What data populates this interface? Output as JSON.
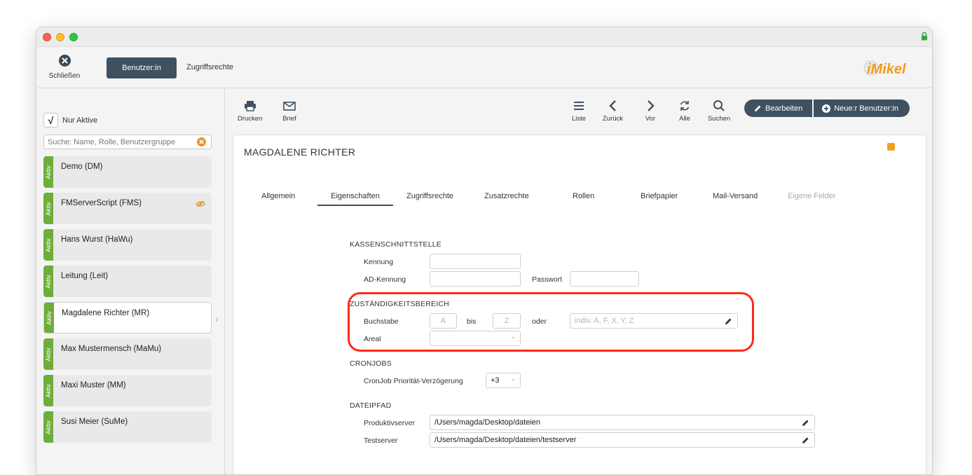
{
  "titlebar": {
    "lock_icon": "lock-icon"
  },
  "topbar": {
    "close_label": "Schließen",
    "tab_user": "Benutzer:in",
    "tab_rights": "Zugriffsrechte",
    "logo_text": "iMikel"
  },
  "sidebar": {
    "only_active_check": "√",
    "only_active_label": "Nur Aktive",
    "search_placeholder": "Suche: Name, Rolle, Benutzergruppe",
    "users": [
      {
        "name": "Demo (DM)",
        "status": "Aktiv"
      },
      {
        "name": "FMServerScript (FMS)",
        "status": "Aktiv"
      },
      {
        "name": "Hans Wurst (HaWu)",
        "status": "Aktiv"
      },
      {
        "name": "Leitung (Leit)",
        "status": "Aktiv"
      },
      {
        "name": "Magdalene Richter (MR)",
        "status": "Aktiv"
      },
      {
        "name": "Max Mustermensch (MaMu)",
        "status": "Aktiv"
      },
      {
        "name": "Maxi Muster (MM)",
        "status": "Aktiv"
      },
      {
        "name": "Susi Meier (SuMe)",
        "status": "Aktiv"
      }
    ]
  },
  "toolbar": {
    "print": "Drucken",
    "letter": "Brief",
    "list": "Liste",
    "back": "Zurück",
    "forward": "Vor",
    "all": "Alle",
    "search": "Suchen",
    "edit": "Bearbeiten",
    "new_user": "Neue:r Benutzer:in"
  },
  "panel": {
    "title": "MAGDALENE RICHTER",
    "tabs": [
      "Allgemein",
      "Eigenschaften",
      "Zugriffsrechte",
      "Zusatzrechte",
      "Rollen",
      "Briefpapier",
      "Mail-Versand",
      "Eigene Felder"
    ],
    "kasse": {
      "heading": "KASSENSCHNITTSTELLE",
      "kennung_label": "Kennung",
      "kennung_value": "",
      "ad_label": "AD-Kennung",
      "ad_value": "",
      "pw_label": "Passwort",
      "pw_value": ""
    },
    "zust": {
      "heading": "ZUSTÄNDIGKEITSBEREICH",
      "buchstabe_label": "Buchstabe",
      "from_placeholder": "A",
      "bis_label": "bis",
      "to_placeholder": "Z",
      "oder_label": "oder",
      "indiv_placeholder": "indiv. A, F, X, Y, Z",
      "areal_label": "Areal",
      "areal_value": ""
    },
    "cron": {
      "heading": "CRONJOBS",
      "delay_label": "CronJob Priorität-Verzögerung",
      "delay_value": "+3"
    },
    "pfad": {
      "heading": "DATEIPFAD",
      "prod_label": "Produktivserver",
      "prod_value": "/Users/magda/Desktop/dateien",
      "test_label": "Testserver",
      "test_value": "/Users/magda/Desktop/dateien/testserver"
    }
  }
}
